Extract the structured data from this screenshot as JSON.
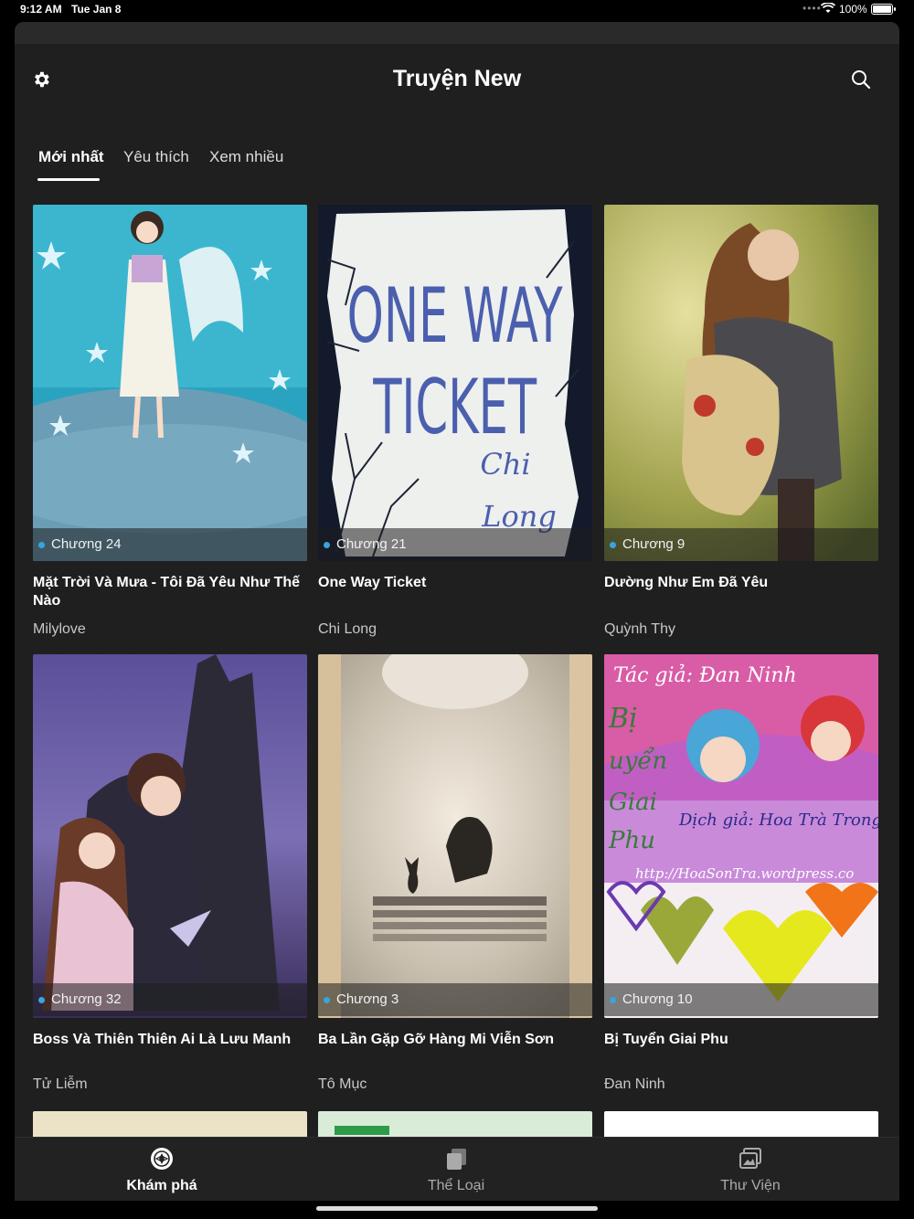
{
  "status_bar": {
    "time": "9:12 AM",
    "date": "Tue Jan 8",
    "battery": "100%",
    "icons": [
      "cellular-dots-icon",
      "wifi-icon",
      "battery-icon"
    ]
  },
  "header": {
    "title": "Truyện New",
    "left_icon": "gear-icon",
    "right_icon": "search-icon"
  },
  "tabs": [
    {
      "label": "Mới nhất",
      "active": true
    },
    {
      "label": "Yêu thích",
      "active": false
    },
    {
      "label": "Xem nhiều",
      "active": false
    }
  ],
  "books": [
    {
      "chapter": "Chương 24",
      "title": "Mặt Trời Và Mưa - Tôi Đã Yêu Như Thế Nào",
      "author": "Milylove"
    },
    {
      "chapter": "Chương 21",
      "title": "One Way Ticket",
      "author": "Chi Long",
      "cover_text": [
        "ONE WAY",
        "TICKET",
        "Chi",
        "Long"
      ]
    },
    {
      "chapter": "Chương 9",
      "title": "Dường Như Em Đã Yêu",
      "author": "Quỳnh Thy"
    },
    {
      "chapter": "Chương 32",
      "title": "Boss Và Thiên Thiên Ai Là Lưu Manh",
      "author": "Tử Liễm"
    },
    {
      "chapter": "Chương 3",
      "title": "Ba Lần Gặp Gỡ Hàng Mi Viễn Sơn",
      "author": "Tô Mục"
    },
    {
      "chapter": "Chương 10",
      "title": "Bị Tuyển Giai Phu",
      "author": "Đan Ninh",
      "cover_text": [
        "Tác giả: Đan Ninh",
        "Bị",
        "uyển",
        "Giai",
        "Phu",
        "Dịch giả: Hoa Trà Trong G",
        "http://HoaSonTra.wordpress.co"
      ]
    }
  ],
  "bottom_nav": [
    {
      "label": "Khám phá",
      "icon": "compass-icon",
      "active": true
    },
    {
      "label": "Thể Loại",
      "icon": "stack-icon",
      "active": false
    },
    {
      "label": "Thư Viện",
      "icon": "library-icon",
      "active": false
    }
  ],
  "colors": {
    "background": "#1f1f1f",
    "accent_dot": "#39a4e0",
    "text_primary": "#ffffff",
    "text_secondary": "#c8c8c8"
  }
}
